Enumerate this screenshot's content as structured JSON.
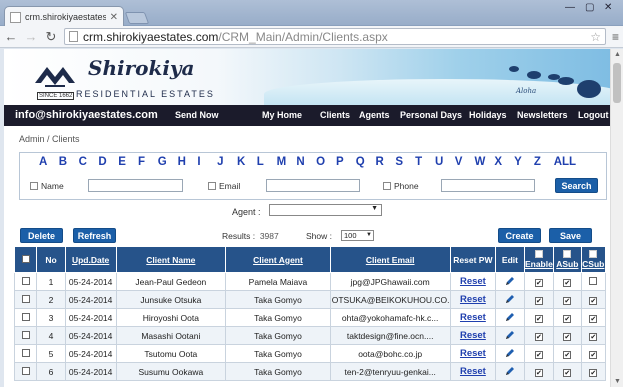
{
  "browser": {
    "tab_title": "crm.shirokiyaestates.com",
    "url_domain": "crm.shirokiyaestates.com",
    "url_path": "/CRM_Main/Admin/Clients.aspx"
  },
  "brand": {
    "name": "Shirokiya",
    "sub": "RESIDENTIAL ESTATES",
    "since": "SINCE 1662",
    "aloha": "Aloha"
  },
  "nav": {
    "email": "info@shirokiyaestates.com",
    "items": [
      "Send Now",
      "My Home",
      "Clients",
      "Agents",
      "Personal Days",
      "Holidays",
      "Newsletters",
      "Logout"
    ]
  },
  "breadcrumb": "Admin / Clients",
  "filter": {
    "letters": [
      "A",
      "B",
      "C",
      "D",
      "E",
      "F",
      "G",
      "H",
      "I",
      "J",
      "K",
      "L",
      "M",
      "N",
      "O",
      "P",
      "Q",
      "R",
      "S",
      "T",
      "U",
      "V",
      "W",
      "X",
      "Y",
      "Z",
      "ALL"
    ],
    "name_label": "Name",
    "email_label": "Email",
    "phone_label": "Phone",
    "search_label": "Search",
    "agent_label": "Agent :"
  },
  "actions": {
    "delete": "Delete",
    "refresh": "Refresh",
    "results_label": "Results :",
    "results_count": "3987",
    "show_label": "Show :",
    "show_value": "100",
    "create": "Create",
    "save": "Save"
  },
  "table": {
    "headers": [
      "No",
      "Upd.Date",
      "Client Name",
      "Client Agent",
      "Client Email",
      "Reset PW",
      "Edit",
      "Enable",
      "ASub",
      "CSub"
    ],
    "reset_label": "Reset",
    "rows": [
      {
        "no": "1",
        "date": "05-24-2014",
        "name": "Jean-Paul Gedeon",
        "agent": "Pamela Maiava",
        "email": "jpg@JPGhawaii.com",
        "enable": true,
        "asub": true,
        "csub": false
      },
      {
        "no": "2",
        "date": "05-24-2014",
        "name": "Junsuke Otsuka",
        "agent": "Taka Gomyo",
        "email": "OTSUKA@BEIKOKUHOU.CO...",
        "enable": true,
        "asub": true,
        "csub": true
      },
      {
        "no": "3",
        "date": "05-24-2014",
        "name": "Hiroyoshi Oota",
        "agent": "Taka Gomyo",
        "email": "ohta@yokohamafc-hk.c...",
        "enable": true,
        "asub": true,
        "csub": true
      },
      {
        "no": "4",
        "date": "05-24-2014",
        "name": "Masashi Ootani",
        "agent": "Taka Gomyo",
        "email": "taktdesign@fine.ocn....",
        "enable": true,
        "asub": true,
        "csub": true
      },
      {
        "no": "5",
        "date": "05-24-2014",
        "name": "Tsutomu Oota",
        "agent": "Taka Gomyo",
        "email": "oota@bohc.co.jp",
        "enable": true,
        "asub": true,
        "csub": true
      },
      {
        "no": "6",
        "date": "05-24-2014",
        "name": "Susumu Ookawa",
        "agent": "Taka Gomyo",
        "email": "ten-2@tenryuu-genkai...",
        "enable": true,
        "asub": true,
        "csub": true
      }
    ]
  },
  "colors": {
    "nav_bg": "#1b1b2b",
    "header_bg": "#26538a",
    "button": "#1b5fa8",
    "link": "#1f3fae"
  }
}
